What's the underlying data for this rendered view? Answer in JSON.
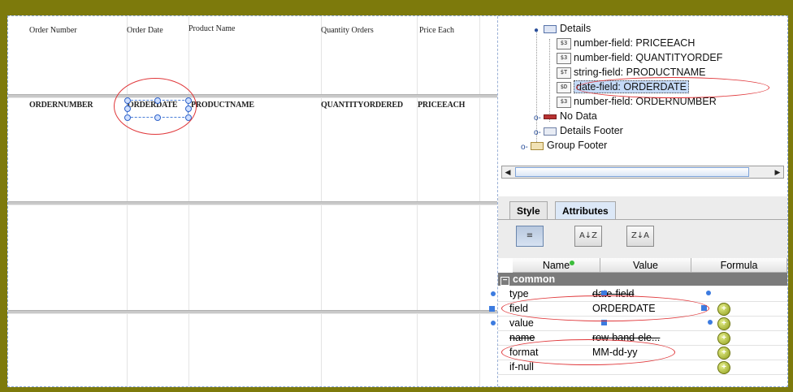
{
  "report": {
    "headers": [
      "Order Number",
      "Order Date",
      "Product Name",
      "Quantity Orders",
      "Price Each"
    ],
    "fields": [
      "ORDERNUMBER",
      "ORDERDATE",
      "PRODUCTNAME",
      "QUANTITYORDERED",
      "PRICEEACH"
    ]
  },
  "tree": {
    "items": [
      {
        "label": "Details",
        "kind": "band"
      },
      {
        "badge": "$3",
        "label": "number-field: PRICEEACH"
      },
      {
        "badge": "$3",
        "label": "number-field: QUANTITYORDEF"
      },
      {
        "badge": "$T",
        "label": "string-field: PRODUCTNAME"
      },
      {
        "badge": "$D",
        "label": "date-field: ORDERDATE",
        "selected": true
      },
      {
        "badge": "$3",
        "label": "number-field: ORDERNUMBER"
      },
      {
        "label": "No Data",
        "kind": "band"
      },
      {
        "label": "Details Footer",
        "kind": "band"
      },
      {
        "label": "Group Footer",
        "kind": "band"
      }
    ]
  },
  "tabs": [
    {
      "label": "Style",
      "active": false
    },
    {
      "label": "Attributes",
      "active": true
    }
  ],
  "toolbar": {
    "btn1": "≡",
    "btn2": "A↓Z",
    "btn3": "Z↓A"
  },
  "attributes": {
    "columns": [
      "Name",
      "Value",
      "Formula"
    ],
    "group": "common",
    "rows": [
      {
        "name": "type",
        "value": "date-field"
      },
      {
        "name": "field",
        "value": "ORDERDATE"
      },
      {
        "name": "value",
        "value": ""
      },
      {
        "name": "name",
        "value": "row-band-ele..."
      },
      {
        "name": "format",
        "value": "MM-dd-yy"
      },
      {
        "name": "if-null",
        "value": ""
      }
    ]
  },
  "colors": {
    "background": "#7d7a0c",
    "highlight": "#e0373a",
    "selection": "#c5daf7",
    "handle": "#3c7be0"
  }
}
